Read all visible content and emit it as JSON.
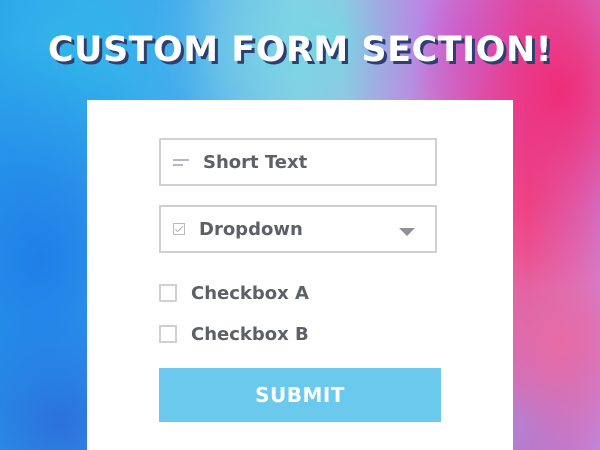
{
  "header": {
    "title": "CUSTOM FORM SECTION!"
  },
  "form": {
    "short_text": {
      "label": "Short Text",
      "icon": "text-lines-icon"
    },
    "dropdown": {
      "label": "Dropdown",
      "icon": "checkbox-icon",
      "chevron": "chevron-down-icon"
    },
    "checkboxes": [
      {
        "label": "Checkbox A",
        "checked": false
      },
      {
        "label": "Checkbox B",
        "checked": false
      }
    ],
    "submit_label": "SUBMIT"
  },
  "colors": {
    "accent": "#6ac9ec",
    "text": "#5e6068",
    "border": "#cfd0d2",
    "title_shadow": "#2d3f6e"
  }
}
